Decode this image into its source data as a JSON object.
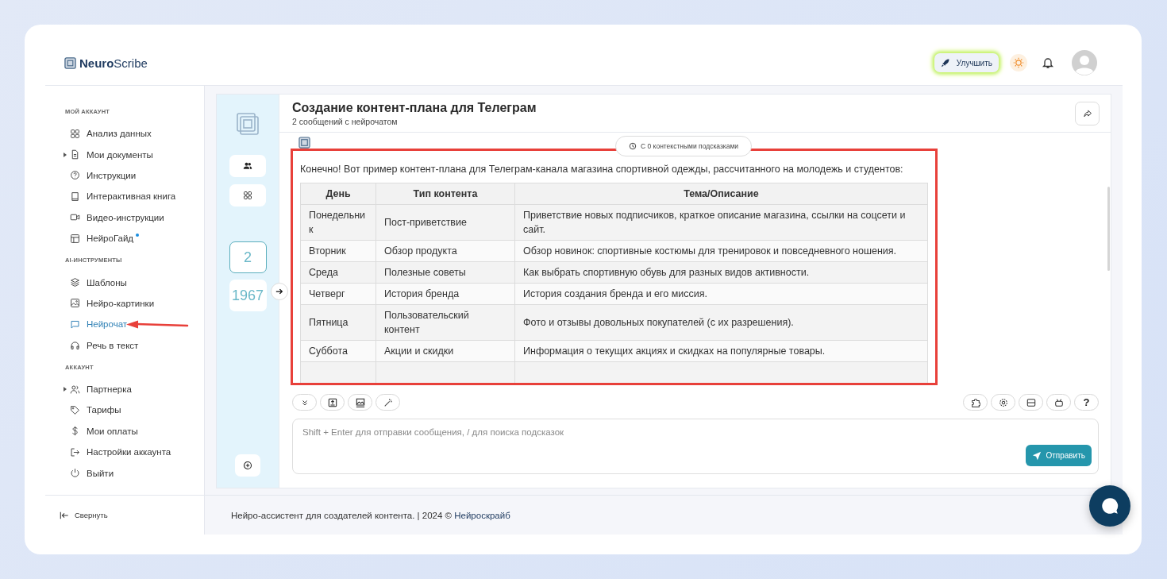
{
  "app": {
    "logo_bold": "Neuro",
    "logo_light": "Scribe"
  },
  "header": {
    "upgrade_label": "Улучшить"
  },
  "sidebar": {
    "sections": [
      {
        "title": "МОЙ АККАУНТ",
        "items": [
          {
            "label": "Анализ данных",
            "kind": "grid",
            "expandable": false,
            "badge_dot": false,
            "selected": false,
            "pointer_arrow": false
          },
          {
            "label": "Мои документы",
            "kind": "document",
            "expandable": true,
            "badge_dot": false,
            "selected": false,
            "pointer_arrow": false
          },
          {
            "label": "Инструкции",
            "kind": "help",
            "expandable": false,
            "badge_dot": false,
            "selected": false,
            "pointer_arrow": false
          },
          {
            "label": "Интерактивная книга",
            "kind": "book",
            "expandable": false,
            "badge_dot": false,
            "selected": false,
            "pointer_arrow": false
          },
          {
            "label": "Видео-инструкции",
            "kind": "video",
            "expandable": false,
            "badge_dot": false,
            "selected": false,
            "pointer_arrow": false
          },
          {
            "label": "НейроГайд",
            "kind": "layout",
            "expandable": false,
            "badge_dot": true,
            "selected": false,
            "pointer_arrow": false
          }
        ]
      },
      {
        "title": "AI-ИНСТРУМЕНТЫ",
        "items": [
          {
            "label": "Шаблоны",
            "kind": "layers",
            "expandable": false,
            "badge_dot": false,
            "selected": false,
            "pointer_arrow": false
          },
          {
            "label": "Нейро-картинки",
            "kind": "image",
            "expandable": false,
            "badge_dot": false,
            "selected": false,
            "pointer_arrow": false
          },
          {
            "label": "Нейрочат",
            "kind": "chat",
            "expandable": false,
            "badge_dot": false,
            "selected": true,
            "pointer_arrow": true
          },
          {
            "label": "Речь в текст",
            "kind": "headphones",
            "expandable": false,
            "badge_dot": false,
            "selected": false,
            "pointer_arrow": false
          }
        ]
      },
      {
        "title": "АККАУНТ",
        "items": [
          {
            "label": "Партнерка",
            "kind": "users",
            "expandable": true,
            "badge_dot": false,
            "selected": false,
            "pointer_arrow": false
          },
          {
            "label": "Тарифы",
            "kind": "tag",
            "expandable": false,
            "badge_dot": false,
            "selected": false,
            "pointer_arrow": false
          },
          {
            "label": "Мои оплаты",
            "kind": "dollar",
            "expandable": false,
            "badge_dot": false,
            "selected": false,
            "pointer_arrow": false
          },
          {
            "label": "Настройки аккаунта",
            "kind": "exit",
            "expandable": false,
            "badge_dot": false,
            "selected": false,
            "pointer_arrow": false
          },
          {
            "label": "Выйти",
            "kind": "power",
            "expandable": false,
            "badge_dot": false,
            "selected": false,
            "pointer_arrow": false
          }
        ]
      }
    ],
    "collapse_label": "Свернуть"
  },
  "chat": {
    "title": "Создание контент-плана для Телеграм",
    "subtitle": "2 сообщений с нейрочатом",
    "counters": [
      {
        "value": "2",
        "selected": true
      },
      {
        "value": "1967",
        "selected": false
      }
    ],
    "context_hint": "С 0 контекстными подсказками",
    "highlighted": true,
    "message_intro": "Конечно! Вот пример контент-плана для Телеграм-канала магазина спортивной одежды, рассчитанного на молодежь и студентов:",
    "table": {
      "columns": [
        "День",
        "Тип контента",
        "Тема/Описание"
      ],
      "rows": [
        [
          "Понедельни к",
          "Пост-приветствие",
          "Приветствие новых подписчиков, краткое описание магазина, ссылки на соцсети и сайт."
        ],
        [
          "Вторник",
          "Обзор продукта",
          "Обзор новинок: спортивные костюмы для тренировок и повседневного ношения."
        ],
        [
          "Среда",
          "Полезные советы",
          "Как выбрать спортивную обувь для разных видов активности."
        ],
        [
          "Четверг",
          "История бренда",
          "История создания бренда и его миссия."
        ],
        [
          "Пятница",
          "Пользовательский контент",
          "Фото и отзывы довольных покупателей (с их разрешения)."
        ],
        [
          "Суббота",
          "Акции и скидки",
          "Информация о текущих акциях и скидках на популярные товары."
        ]
      ]
    },
    "input_placeholder": "Shift + Enter для отправки сообщения, / для поиска подсказок",
    "help_label": "?",
    "send_label": "Отправить"
  },
  "footer": {
    "text": "Нейро-ассистент для создателей контента.  | 2024 © ",
    "link": "Нейроскрайб"
  }
}
